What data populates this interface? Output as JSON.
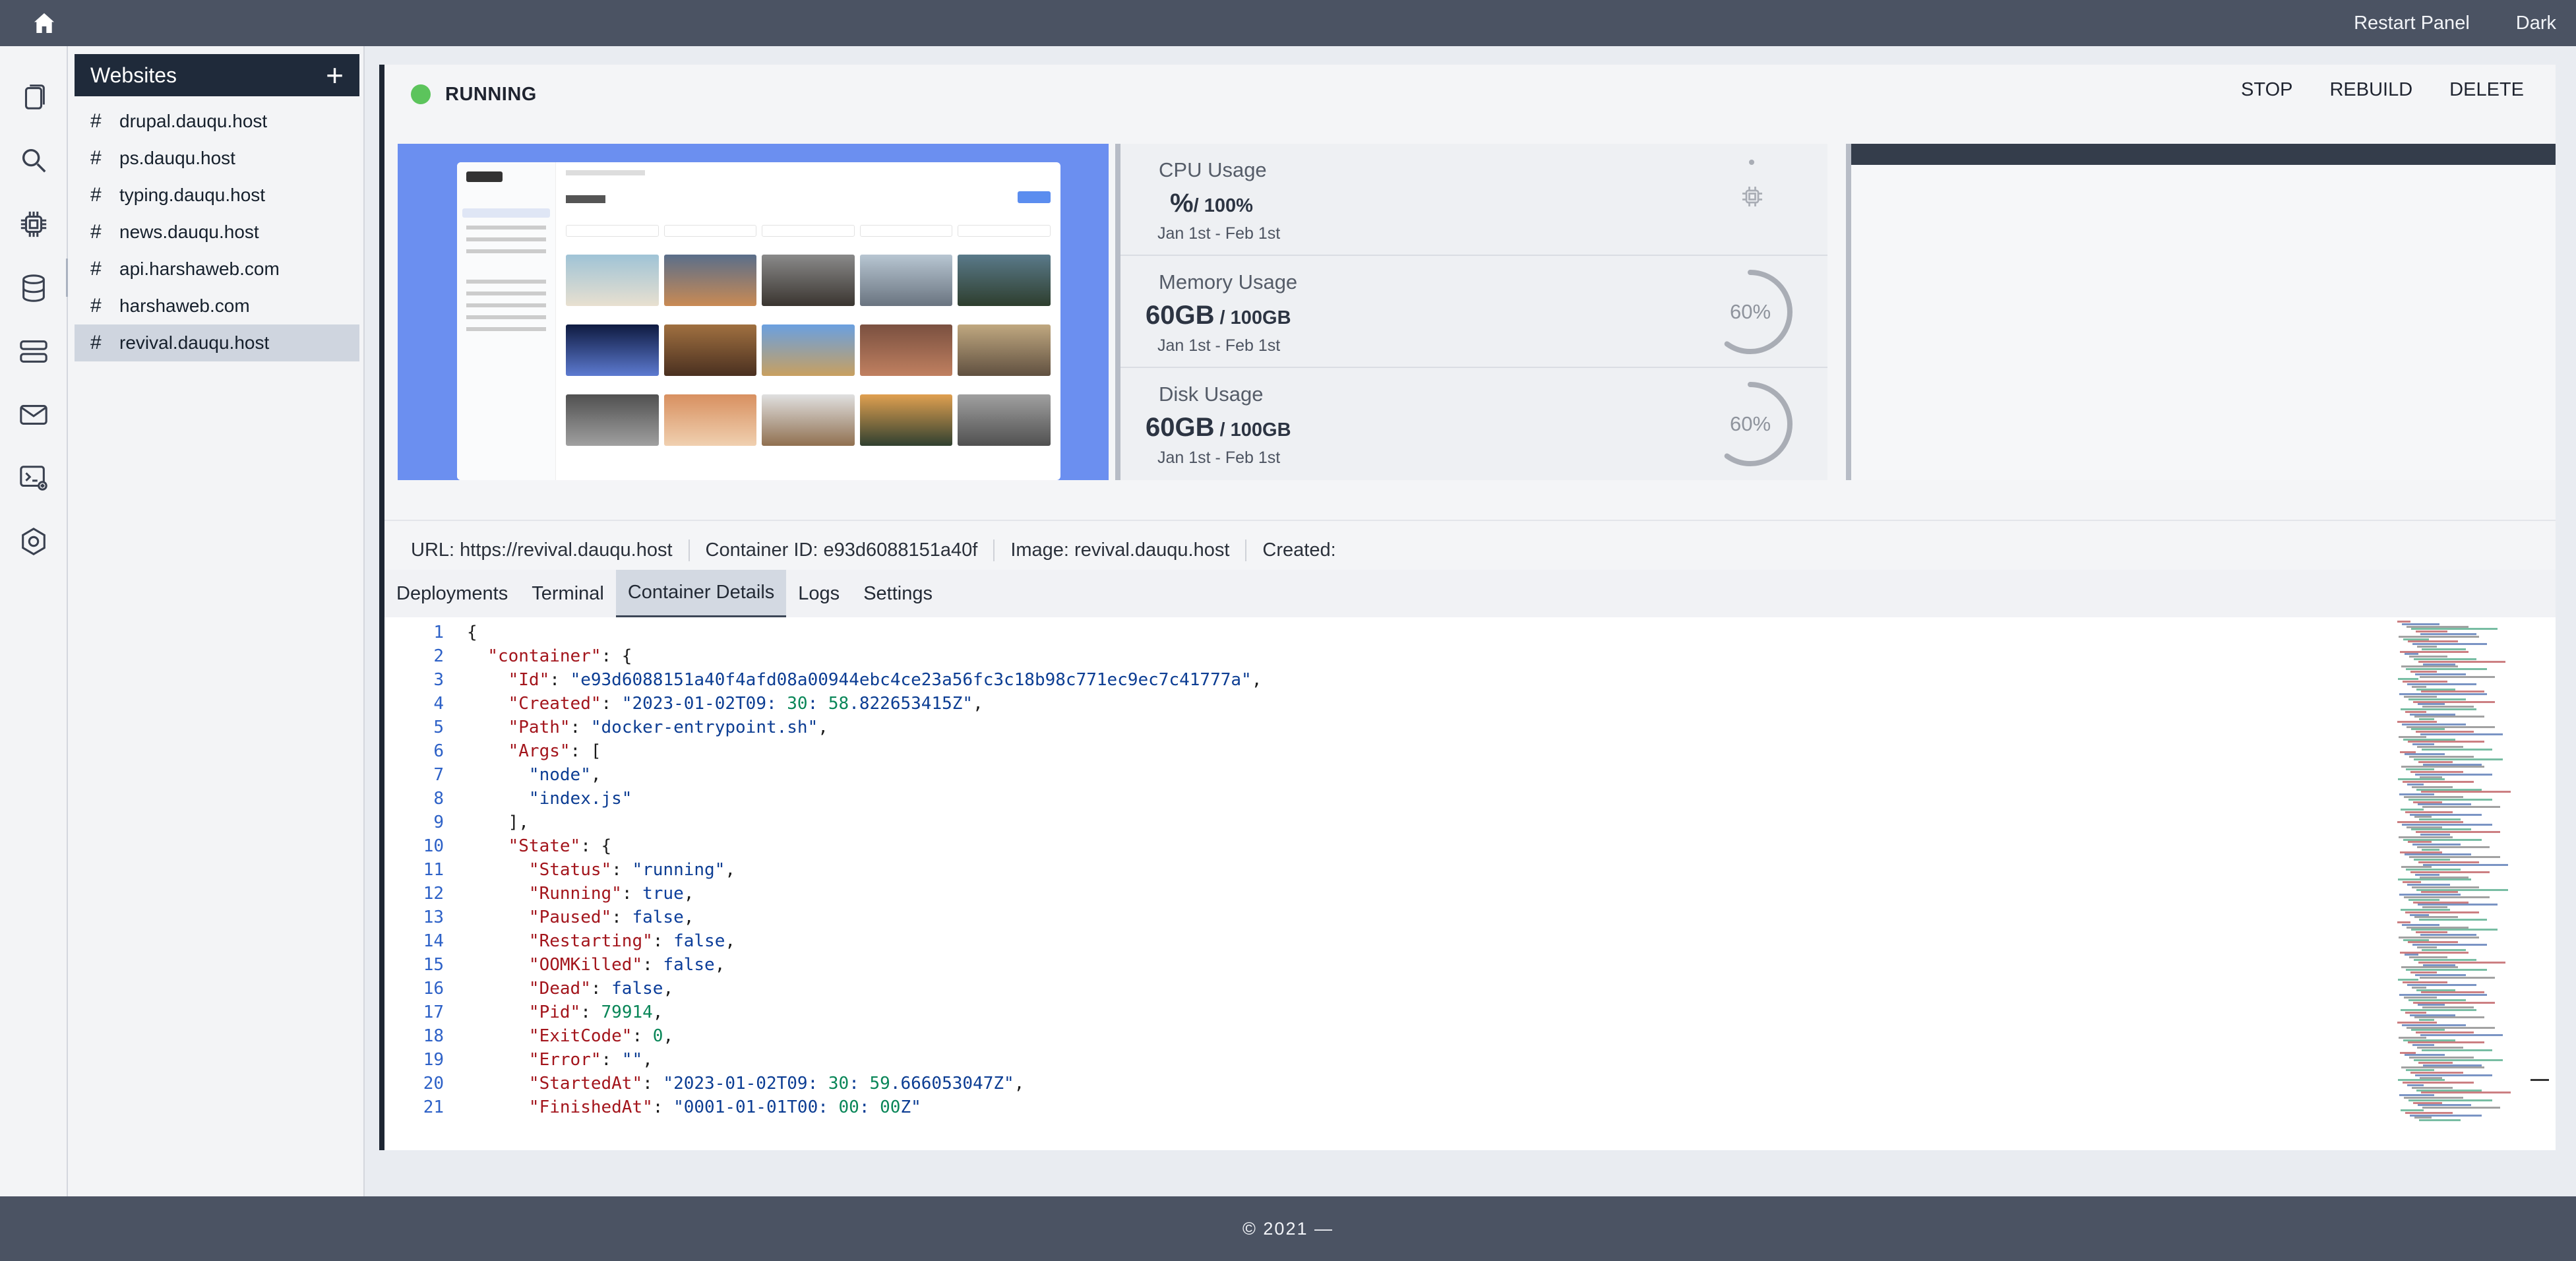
{
  "topbar": {
    "restart_label": "Restart Panel",
    "theme_label": "Dark"
  },
  "sidebar": {
    "title": "Websites",
    "add": "+",
    "hash": "#",
    "items": [
      {
        "label": "drupal.dauqu.host"
      },
      {
        "label": "ps.dauqu.host"
      },
      {
        "label": "typing.dauqu.host"
      },
      {
        "label": "news.dauqu.host"
      },
      {
        "label": "api.harshaweb.com"
      },
      {
        "label": "harshaweb.com"
      },
      {
        "label": "revival.dauqu.host"
      }
    ],
    "selected_index": 6
  },
  "rail_icons": [
    "pages-icon",
    "search-icon",
    "cpu-icon",
    "database-icon",
    "server-icon",
    "mail-icon",
    "terminal-icon",
    "settings-icon"
  ],
  "status": {
    "label": "RUNNING",
    "color": "#5cc45c"
  },
  "actions": {
    "stop": "STOP",
    "rebuild": "REBUILD",
    "delete": "DELETE"
  },
  "stats": {
    "cpu": {
      "label": "CPU Usage",
      "value": "%",
      "total": "/ 100%",
      "range": "Jan 1st - Feb 1st"
    },
    "memory": {
      "label": "Memory Usage",
      "value": "60GB",
      "total": " / 100GB",
      "range": "Jan 1st - Feb 1st",
      "percent": "60%",
      "fraction": 0.6
    },
    "disk": {
      "label": "Disk Usage",
      "value": "60GB",
      "total": " / 100GB",
      "range": "Jan 1st - Feb 1st",
      "percent": "60%",
      "fraction": 0.6
    }
  },
  "meta": {
    "url": "URL: https://revival.dauqu.host",
    "container_id": "Container ID: e93d6088151a40f",
    "image": "Image: revival.dauqu.host",
    "created": "Created:"
  },
  "tabs": [
    "Deployments",
    "Terminal",
    "Container Details",
    "Logs",
    "Settings"
  ],
  "active_tab": "Container Details",
  "code_lines": [
    "{",
    "  \"container\": {",
    "    \"Id\": \"e93d6088151a40f4afd08a00944ebc4ce23a56fc3c18b98c771ec9ec7c41777a\",",
    "    \"Created\": \"2023-01-02T09:30:58.822653415Z\",",
    "    \"Path\": \"docker-entrypoint.sh\",",
    "    \"Args\": [",
    "      \"node\",",
    "      \"index.js\"",
    "    ],",
    "    \"State\": {",
    "      \"Status\": \"running\",",
    "      \"Running\": true,",
    "      \"Paused\": false,",
    "      \"Restarting\": false,",
    "      \"OOMKilled\": false,",
    "      \"Dead\": false,",
    "      \"Pid\": 79914,",
    "      \"ExitCode\": 0,",
    "      \"Error\": \"\",",
    "      \"StartedAt\": \"2023-01-02T09:30:59.666053047Z\",",
    "      \"FinishedAt\": \"0001-01-01T00:00:00Z\""
  ],
  "footer": "© 2021 —"
}
